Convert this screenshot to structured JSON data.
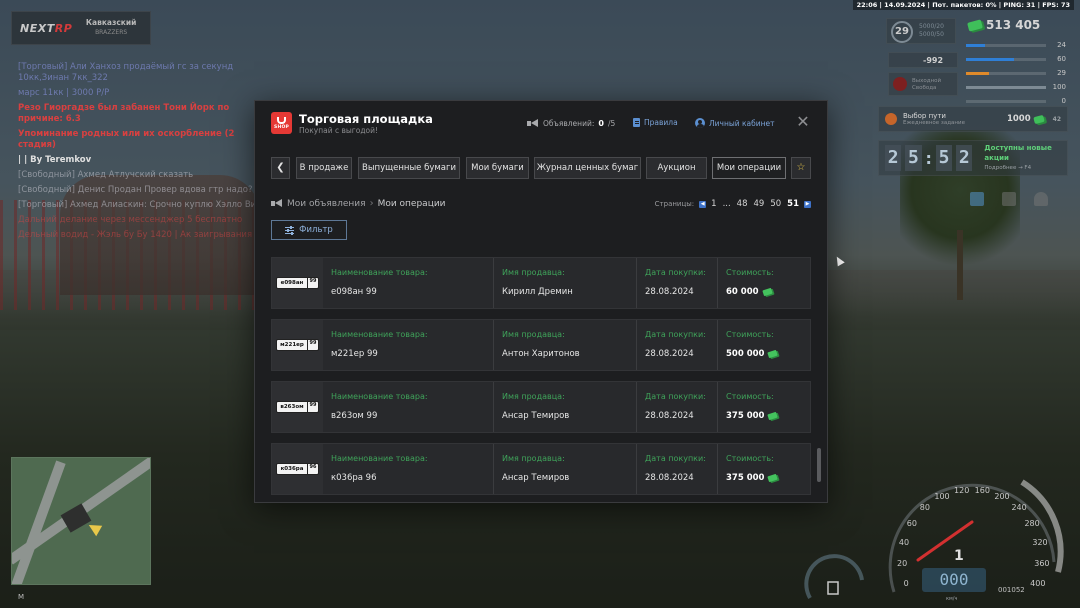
{
  "status": {
    "text": "22:06 | 14.09.2024 | Пот. пакетов: 0% | PING: 31 | FPS: 73"
  },
  "server_logo": {
    "brand_a": "NEXT",
    "brand_b": "RP",
    "server_name": "Кавказский",
    "server_sub": "BRAZZERS"
  },
  "chat": {
    "lines": [
      {
        "text": "[Торговый] Али Ханхоз продаёмый гс за секунд 10кк,Зинан 7кк_322",
        "style": "blue"
      },
      {
        "text": "марс 11кк | 3000 Р/Р",
        "style": "blue"
      },
      {
        "text": "Резо Гиоргадзе был забанен Тони Йорк по причине: 6.3",
        "style": "red"
      },
      {
        "text": "Упоминание родных или их оскорбление (2 стадия)",
        "style": "red"
      },
      {
        "text": "| | By Teremkov",
        "style": "white"
      },
      {
        "text": "[Свободный] Ахмед Атлучский сказать",
        "style": "dim"
      },
      {
        "text": "[Свободный] Денис Продан Провер вдова гтр надо?",
        "style": "dim"
      },
      {
        "text": "[Торговый] Ахмед Алиаскин: Срочно куплю Хэлло Вин",
        "style": "dim"
      },
      {
        "text": "Дальний делание через мессенджер 5 бесплатно",
        "style": "dimred"
      },
      {
        "text": "Дельный водид - Жэль бу Бу 1420 | Ак заигрывания",
        "style": "dimred"
      }
    ]
  },
  "hud": {
    "level": "29",
    "exp": "5000/20\n5000/50",
    "money": "513 405",
    "minus": "-992",
    "wanted_label": "Выходной\nСвобода",
    "stats": [
      {
        "value": "24",
        "color": "#2f7fd6",
        "fill": 0.24
      },
      {
        "value": "60",
        "color": "#2f7fd6",
        "fill": 0.6
      },
      {
        "value": "29",
        "color": "#e08a2a",
        "fill": 0.29
      },
      {
        "value": "100",
        "color": "#7d8a94",
        "fill": 1.0
      },
      {
        "value": "0",
        "color": "#7d8a94",
        "fill": 0.0
      }
    ],
    "task": {
      "title": "Выбор пути",
      "subtitle": "Ежедневное задание",
      "count": "1000",
      "extra": "42"
    },
    "timer": {
      "h1": "2",
      "h2": "5",
      "m1": "5",
      "m2": "2",
      "title": "Доступны новые акции",
      "subtitle": "Подробнее → F4"
    }
  },
  "minimap": {
    "label": "M"
  },
  "speedometer": {
    "ticks": [
      "0",
      "20",
      "40",
      "60",
      "80",
      "100",
      "120",
      "160",
      "200",
      "240",
      "280",
      "320",
      "360",
      "400"
    ],
    "speed": "000",
    "gear": "1",
    "unit": "км/ч",
    "mileage": "001052"
  },
  "marketplace": {
    "title": "Торговая площадка",
    "subtitle": "Покупай с выгодой!",
    "shop_label": "SHOP",
    "ads_label": "Объявлений:",
    "ads_count": "0",
    "ads_max": "/5",
    "rules_link": "Правила",
    "cabinet_link": "Личный кабинет",
    "close_icon": "✕",
    "tabs": [
      {
        "label": "В продаже",
        "active": false
      },
      {
        "label": "Выпущенные бумаги",
        "active": false
      },
      {
        "label": "Мои бумаги",
        "active": false
      },
      {
        "label": "Журнал ценных бумаг",
        "active": false
      },
      {
        "label": "Аукцион",
        "active": false
      },
      {
        "label": "Мои операции",
        "active": true
      }
    ],
    "breadcrumb": {
      "first": "Мои объявления",
      "second": "Мои операции"
    },
    "pager": {
      "label": "Страницы:",
      "pages": [
        "1",
        "...",
        "48",
        "49",
        "50",
        "51"
      ],
      "current": "51"
    },
    "filter_label": "Фильтр",
    "columns": {
      "item": "Наименование товара:",
      "seller": "Имя продавца:",
      "date": "Дата покупки:",
      "price": "Стоимость:"
    },
    "operations": [
      {
        "plate_num": "е098ан",
        "plate_region": "99",
        "item": "е098ан 99",
        "seller": "Кирилл Дремин",
        "date": "28.08.2024",
        "price": "60 000"
      },
      {
        "plate_num": "м221ер",
        "plate_region": "99",
        "item": "м221ер 99",
        "seller": "Антон Харитонов",
        "date": "28.08.2024",
        "price": "500 000"
      },
      {
        "plate_num": "в263ом",
        "plate_region": "99",
        "item": "в263ом 99",
        "seller": "Ансар Темиров",
        "date": "28.08.2024",
        "price": "375 000"
      },
      {
        "plate_num": "к036ра",
        "plate_region": "96",
        "item": "к036ра 96",
        "seller": "Ансар Темиров",
        "date": "28.08.2024",
        "price": "375 000"
      }
    ]
  }
}
